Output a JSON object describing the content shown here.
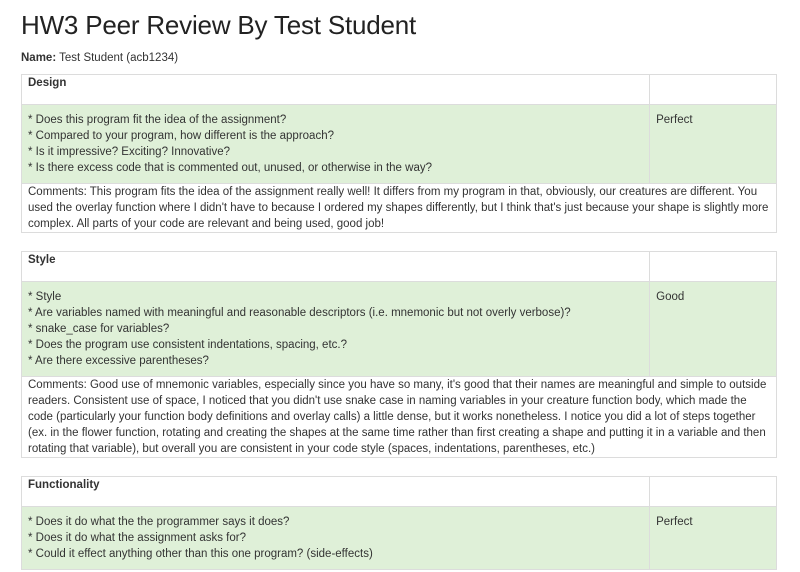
{
  "title": "HW3 Peer Review By Test Student",
  "name_label": "Name:",
  "name_value": "Test Student (acb1234)",
  "sections": [
    {
      "header": "Design",
      "questions": [
        "* Does this program fit the idea of the assignment?",
        "* Compared to your program, how different is the approach?",
        "* Is it impressive? Exciting? Innovative?",
        "* Is there excess code that is commented out, unused, or otherwise in the way?"
      ],
      "rating": "Perfect",
      "comments": "Comments: This program fits the idea of the assignment really well! It differs from my program in that, obviously, our creatures are different. You used the overlay function where I didn't have to because I ordered my shapes differently, but I think that's just because your shape is slightly more complex. All parts of your code are relevant and being used, good job!"
    },
    {
      "header": "Style",
      "questions": [
        "* Style",
        "* Are variables named with meaningful and reasonable descriptors (i.e. mnemonic but not overly verbose)?",
        "* snake_case for variables?",
        "* Does the program use consistent indentations, spacing, etc.?",
        "* Are there excessive parentheses?"
      ],
      "rating": "Good",
      "comments": "Comments: Good use of mnemonic variables, especially since you have so many, it's good that their names are meaningful and simple to outside readers. Consistent use of space, I noticed that you didn't use snake case in naming variables in your creature function body, which made the code (particularly your function body definitions and overlay calls) a little dense, but it works nonetheless. I notice you did a lot of steps together (ex. in the flower function, rotating and creating the shapes at the same time rather than first creating a shape and putting it in a variable and then rotating that variable), but overall you are consistent in your code style (spaces, indentations, parentheses, etc.)"
    },
    {
      "header": "Functionality",
      "questions": [
        "* Does it do what the the programmer says it does?",
        "* Does it do what the assignment asks for?",
        "* Could it effect anything other than this one program? (side-effects)"
      ],
      "rating": "Perfect",
      "comments": ""
    }
  ]
}
